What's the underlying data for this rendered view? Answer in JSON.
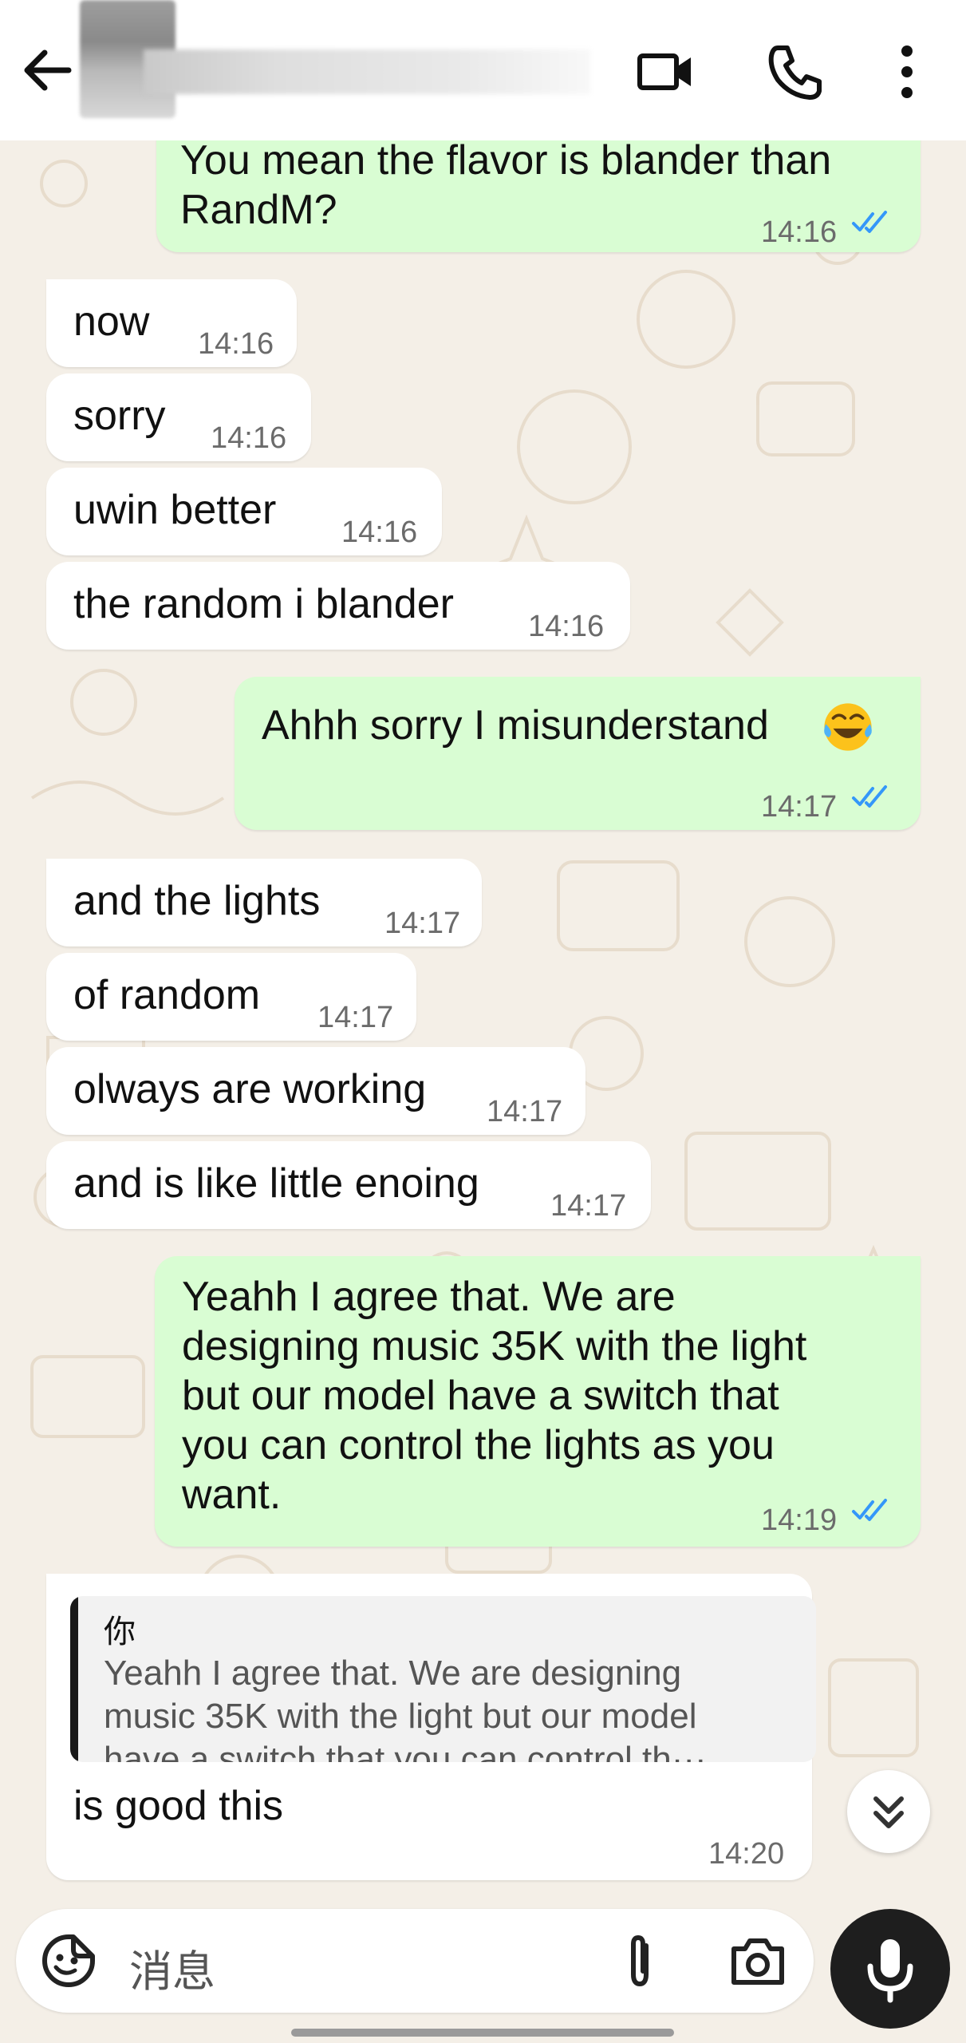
{
  "header": {
    "back_icon": "arrow-left-icon",
    "video_icon": "video-camera-icon",
    "call_icon": "phone-icon",
    "menu_icon": "more-vertical-icon"
  },
  "messages": [
    {
      "dir": "out",
      "text": "You mean the flavor is blander than\nRandM?",
      "time": "14:16",
      "read": true
    },
    {
      "dir": "in",
      "text": "now",
      "time": "14:16"
    },
    {
      "dir": "in",
      "text": "sorry",
      "time": "14:16"
    },
    {
      "dir": "in",
      "text": "uwin better",
      "time": "14:16"
    },
    {
      "dir": "in",
      "text": "the random i blander",
      "time": "14:16"
    },
    {
      "dir": "out",
      "text": "Ahhh sorry I misunderstand",
      "emoji": "face-with-tears-of-joy",
      "time": "14:17",
      "read": true
    },
    {
      "dir": "in",
      "text": "and the lights",
      "time": "14:17"
    },
    {
      "dir": "in",
      "text": "of random",
      "time": "14:17"
    },
    {
      "dir": "in",
      "text": "olways are working",
      "time": "14:17"
    },
    {
      "dir": "in",
      "text": "and is like little enoing",
      "time": "14:17"
    },
    {
      "dir": "out",
      "text": "Yeahh I agree that. We are\ndesigning music 35K with the light\nbut our model have a switch that\nyou can control the lights as you\nwant.",
      "time": "14:19",
      "read": true
    },
    {
      "dir": "in",
      "quote": {
        "author": "你",
        "text": "Yeahh I agree that. We are designing\nmusic 35K with the light but our model\nhave a switch that you can control th···"
      },
      "text": "is good this",
      "time": "14:20"
    }
  ],
  "composer": {
    "placeholder": "消息",
    "emoji_icon": "sticker-smiley-icon",
    "attach_icon": "paperclip-icon",
    "camera_icon": "camera-icon",
    "mic_icon": "microphone-icon"
  },
  "scroll_button_icon": "double-chevron-down-icon",
  "colors": {
    "outgoing_bubble": "#d9fdd3",
    "incoming_bubble": "#ffffff",
    "read_ticks": "#3497f9",
    "wallpaper": "#f4efe7"
  }
}
